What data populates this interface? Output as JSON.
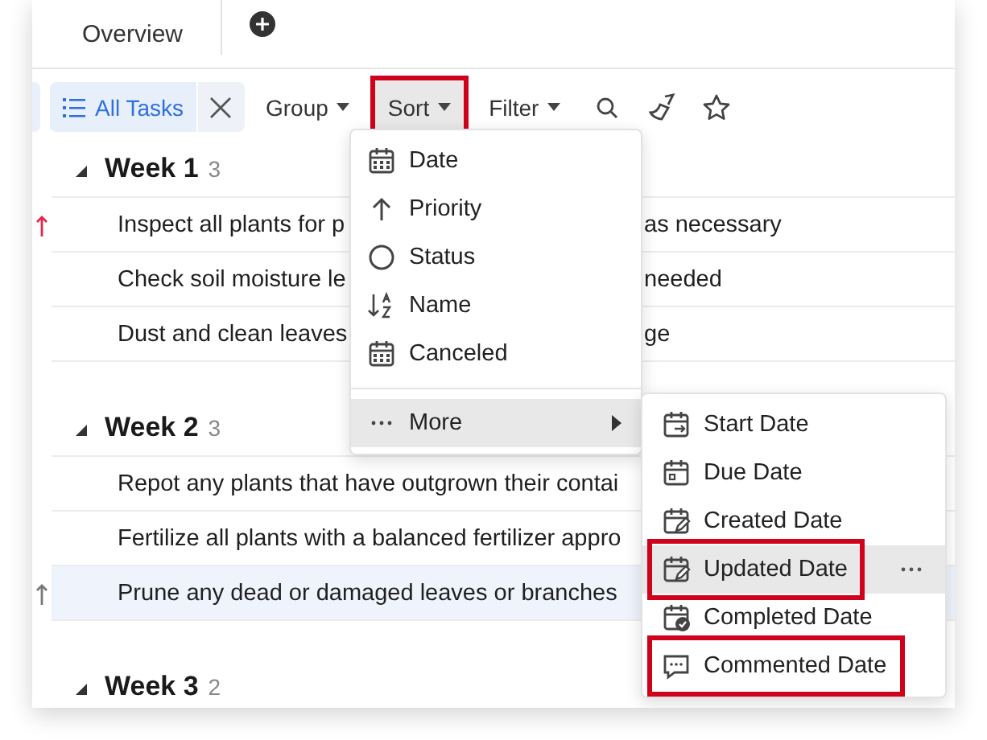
{
  "tabs": [
    {
      "label": "Overview",
      "selected": false
    }
  ],
  "toolbar": {
    "view": "All Tasks",
    "buttons": [
      {
        "label": "Group",
        "highlighted": false,
        "open": false
      },
      {
        "label": "Sort",
        "highlighted": true,
        "open": true
      },
      {
        "label": "Filter",
        "highlighted": false,
        "open": false
      }
    ]
  },
  "groups": [
    {
      "title": "Week 1",
      "count": "3",
      "expanded": true,
      "tasks": [
        {
          "segments": [
            "Inspect all plants for p",
            "as necessary"
          ],
          "priority": true,
          "color": "#e0284a",
          "selected": false
        },
        {
          "segments": [
            "Check soil moisture le",
            "needed"
          ],
          "priority": false,
          "selected": false
        },
        {
          "segments": [
            "Dust and clean leaves",
            "ge"
          ],
          "priority": false,
          "selected": false
        }
      ]
    },
    {
      "title": "Week 2",
      "count": "3",
      "expanded": true,
      "tasks": [
        {
          "segments": [
            "Repot any plants that have outgrown their contai"
          ],
          "priority": false,
          "selected": false
        },
        {
          "segments": [
            "Fertilize all plants with a balanced fertilizer appro"
          ],
          "priority": false,
          "selected": false
        },
        {
          "segments": [
            "Prune any dead or damaged leaves or branches"
          ],
          "priority": true,
          "color": "#777777",
          "selected": true
        }
      ]
    },
    {
      "title": "Week 3",
      "count": "2",
      "expanded": true
    }
  ],
  "sort_menu": {
    "items": [
      {
        "label": "Date",
        "kind": "calendar",
        "hovered": false
      },
      {
        "label": "Priority",
        "kind": "arrow",
        "hovered": false
      },
      {
        "label": "Status",
        "kind": "circle",
        "hovered": false
      },
      {
        "label": "Name",
        "kind": "az",
        "hovered": false
      },
      {
        "label": "Canceled",
        "kind": "calendar",
        "hovered": false
      },
      {
        "label": "More",
        "kind": "more",
        "hovered": true,
        "submenu": true
      }
    ]
  },
  "more_menu": {
    "items": [
      {
        "label": "Start Date",
        "kind": "start",
        "hovered": false,
        "highlighted": false
      },
      {
        "label": "Due Date",
        "kind": "due",
        "hovered": false,
        "highlighted": false
      },
      {
        "label": "Created Date",
        "kind": "edit",
        "hovered": false,
        "highlighted": false
      },
      {
        "label": "Updated Date",
        "kind": "edit",
        "hovered": true,
        "highlighted": true
      },
      {
        "label": "Completed Date",
        "kind": "done",
        "hovered": false,
        "highlighted": false
      },
      {
        "label": "Commented Date",
        "kind": "comment",
        "hovered": false,
        "highlighted": true
      }
    ]
  }
}
